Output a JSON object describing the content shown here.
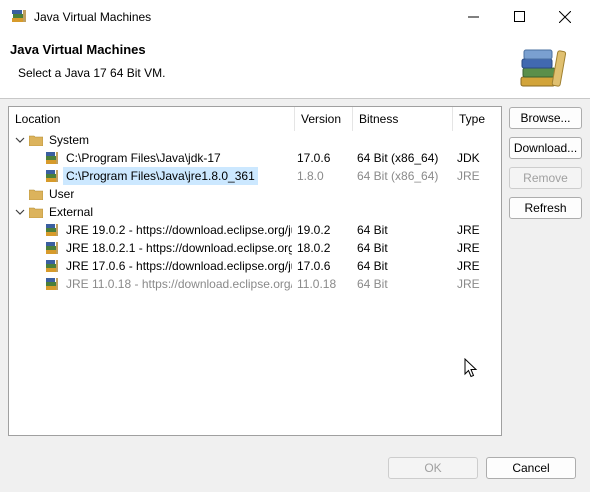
{
  "window": {
    "title": "Java Virtual Machines"
  },
  "header": {
    "title": "Java Virtual Machines",
    "subtitle": "Select a Java 17 64 Bit VM."
  },
  "table": {
    "columns": [
      "Location",
      "Version",
      "Bitness",
      "Type"
    ],
    "groups": [
      {
        "label": "System",
        "rows": [
          {
            "location": "C:\\Program Files\\Java\\jdk-17",
            "version": "17.0.6",
            "bitness": "64 Bit (x86_64)",
            "type": "JDK"
          },
          {
            "location": "C:\\Program Files\\Java\\jre1.8.0_361",
            "version": "1.8.0",
            "bitness": "64 Bit (x86_64)",
            "type": "JRE"
          }
        ]
      },
      {
        "label": "User"
      },
      {
        "label": "External",
        "rows": [
          {
            "location": "JRE 19.0.2 - https://download.eclipse.org/ju",
            "version": "19.0.2",
            "bitness": "64 Bit",
            "type": "JRE"
          },
          {
            "location": "JRE 18.0.2.1 - https://download.eclipse.org/",
            "version": "18.0.2",
            "bitness": "64 Bit",
            "type": "JRE"
          },
          {
            "location": "JRE 17.0.6 - https://download.eclipse.org/ju",
            "version": "17.0.6",
            "bitness": "64 Bit",
            "type": "JRE"
          },
          {
            "location": "JRE 11.0.18 - https://download.eclipse.org/_",
            "version": "11.0.18",
            "bitness": "64 Bit",
            "type": "JRE"
          }
        ]
      }
    ]
  },
  "buttons": {
    "browse": "Browse...",
    "download": "Download...",
    "remove": "Remove",
    "refresh": "Refresh",
    "ok": "OK",
    "cancel": "Cancel"
  },
  "colors": {
    "selection": "#cce8ff",
    "folder": "#dcb35c",
    "disabled_text": "#8a8a8a"
  }
}
